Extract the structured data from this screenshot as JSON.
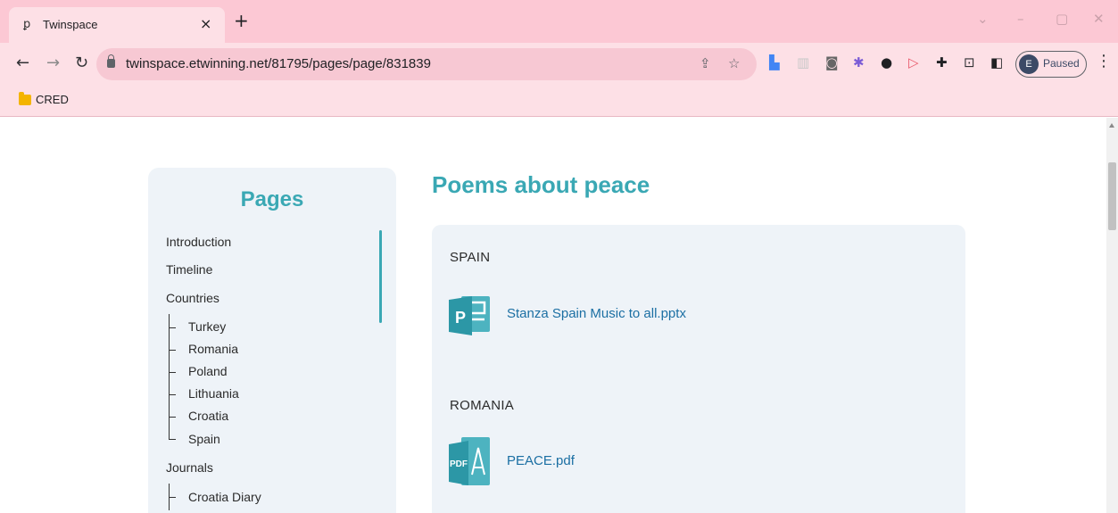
{
  "browser": {
    "tab": {
      "title": "Twinspace",
      "favicon": "twinspace-favicon"
    },
    "new_tab_icon": "plus-icon",
    "window_controls": [
      "chevron-down-icon",
      "minimize-icon",
      "restore-icon",
      "close-icon"
    ],
    "url": "twinspace.etwinning.net/81795/pages/page/831839",
    "omnibox_icons": [
      "share-icon",
      "star-icon"
    ],
    "extensions": [
      "translate-icon",
      "reader-icon",
      "camera-icon",
      "gear-flower-icon",
      "chat-icon",
      "play-icon",
      "puzzle-icon",
      "cast-icon",
      "sidepanel-icon"
    ],
    "profile": {
      "initial": "E",
      "status": "Paused"
    },
    "bookmarks": [
      {
        "label": "CRED",
        "icon": "folder-icon"
      }
    ],
    "colors": {
      "chrome": "#fcc8d4",
      "toolbar": "#fde0e6"
    }
  },
  "sidebar": {
    "title": "Pages",
    "items": [
      {
        "label": "Introduction"
      },
      {
        "label": "Timeline"
      },
      {
        "label": "Countries",
        "children": [
          "Turkey",
          "Romania",
          "Poland",
          "Lithuania",
          "Croatia",
          "Spain"
        ]
      },
      {
        "label": "Journals",
        "children": [
          "Croatia Diary"
        ]
      }
    ]
  },
  "main": {
    "title": "Poems about peace",
    "sections": [
      {
        "country": "SPAIN",
        "file": {
          "name": "Stanza Spain Music to all.pptx",
          "type": "pptx-icon"
        }
      },
      {
        "country": "ROMANIA",
        "file": {
          "name": "PEACE.pdf",
          "type": "pdf-icon"
        }
      }
    ]
  },
  "theme": {
    "accent": "#3aa8b4",
    "link": "#1b6fa3",
    "panel": "#eef3f8"
  }
}
